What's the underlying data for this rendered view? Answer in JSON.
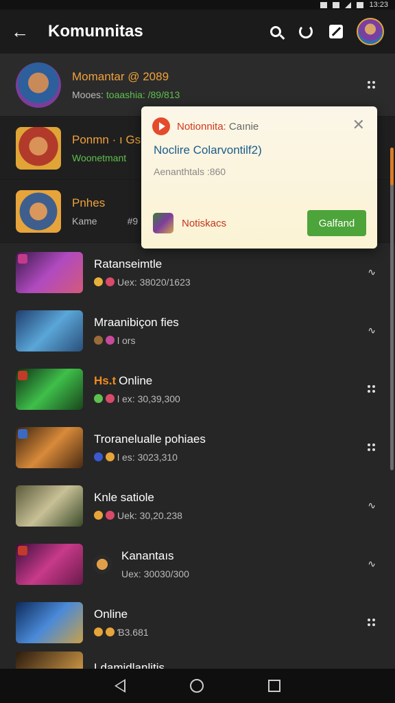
{
  "status_bar": {
    "time": "13:23"
  },
  "app_bar": {
    "title": "Komunnitas",
    "icons": [
      "back-arrow-icon",
      "search-icon",
      "refresh-icon",
      "compose-icon",
      "profile-avatar"
    ]
  },
  "top_items": [
    {
      "title": "Momantar @ 2089",
      "subtitle_prefix": "Mooes:",
      "subtitle_rest": "toaashia: /89/813"
    },
    {
      "title": "Ponmn · ı Gsa",
      "subtitle": "Woonetmant"
    },
    {
      "title": "Pnhes",
      "subtitle": "Kame",
      "subtitle_extra": "#9"
    }
  ],
  "games": [
    {
      "title": "Ratanseimtle",
      "meta": "Uex: 38020/1623"
    },
    {
      "title": "Mraanibiçon fies",
      "meta": "l ors"
    },
    {
      "badge": "Hs.t",
      "title": "Online",
      "meta": "l ex: 30,39,300"
    },
    {
      "title": "Troranelualle pohiaes",
      "meta": "l es: 3023,310"
    },
    {
      "title": "Knle satiole",
      "meta": "Uek: 30,20.238"
    },
    {
      "title": "Kanantaıs",
      "meta": "Uex: 30030/300"
    },
    {
      "title": "Online",
      "meta": "Ɓ3.681"
    },
    {
      "title": "Ldamidlanlitis"
    }
  ],
  "notification": {
    "app_name": "Notionnita:",
    "app_suffix": "Caınie",
    "title": "Noclire Colarvontilf2)",
    "body": "Aenanthtals :860",
    "footer_label": "Notiskacs",
    "action_label": "Galfand"
  },
  "colors": {
    "accent_orange": "#f0a23a",
    "link_blue": "#1a5d8c",
    "action_green": "#4da43a",
    "notif_red": "#d0391e"
  }
}
